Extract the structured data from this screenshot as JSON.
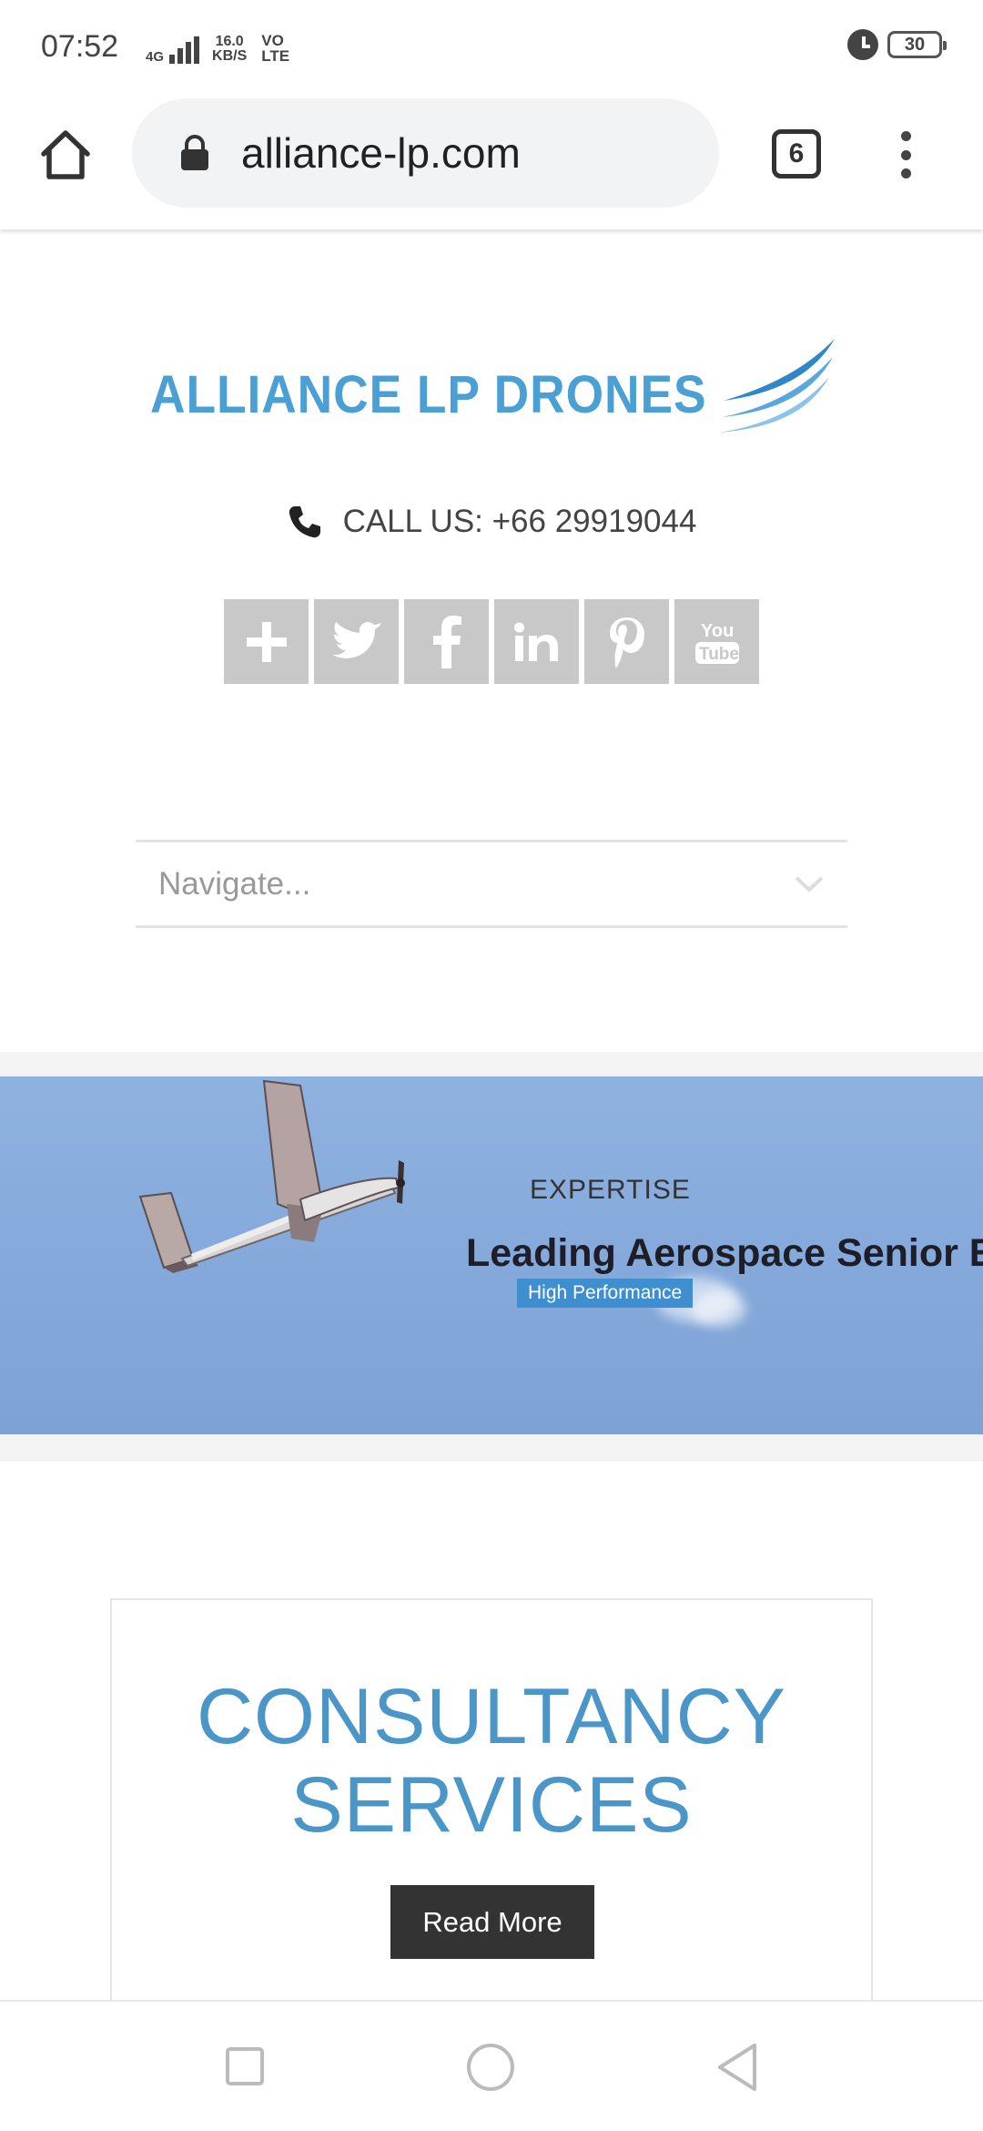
{
  "status_bar": {
    "time": "07:52",
    "network": "4G",
    "speed_value": "16.0",
    "speed_unit": "KB/S",
    "volte_top": "VO",
    "volte_bottom": "LTE",
    "battery": "30"
  },
  "browser": {
    "url": "alliance-lp.com",
    "tab_count": "6"
  },
  "site": {
    "logo_text": "ALLIANCE LP DRONES",
    "call_label": "CALL US: +66 29919044",
    "social": [
      "google-plus-icon",
      "twitter-icon",
      "facebook-icon",
      "linkedin-icon",
      "pinterest-icon",
      "youtube-icon"
    ],
    "nav_placeholder": "Navigate...",
    "banner": {
      "kicker": "EXPERTISE",
      "title": "Leading Aerospace Senior Engineers",
      "tag": "High Performance"
    },
    "consult": {
      "title_line1": "CONSULTANCY",
      "title_line2": "SERVICES",
      "button": "Read More"
    }
  },
  "colors": {
    "brand_blue": "#4a9fd4",
    "button_dark": "#333333",
    "social_grey": "#c8c8c8",
    "tag_blue": "#3f8fd0"
  }
}
